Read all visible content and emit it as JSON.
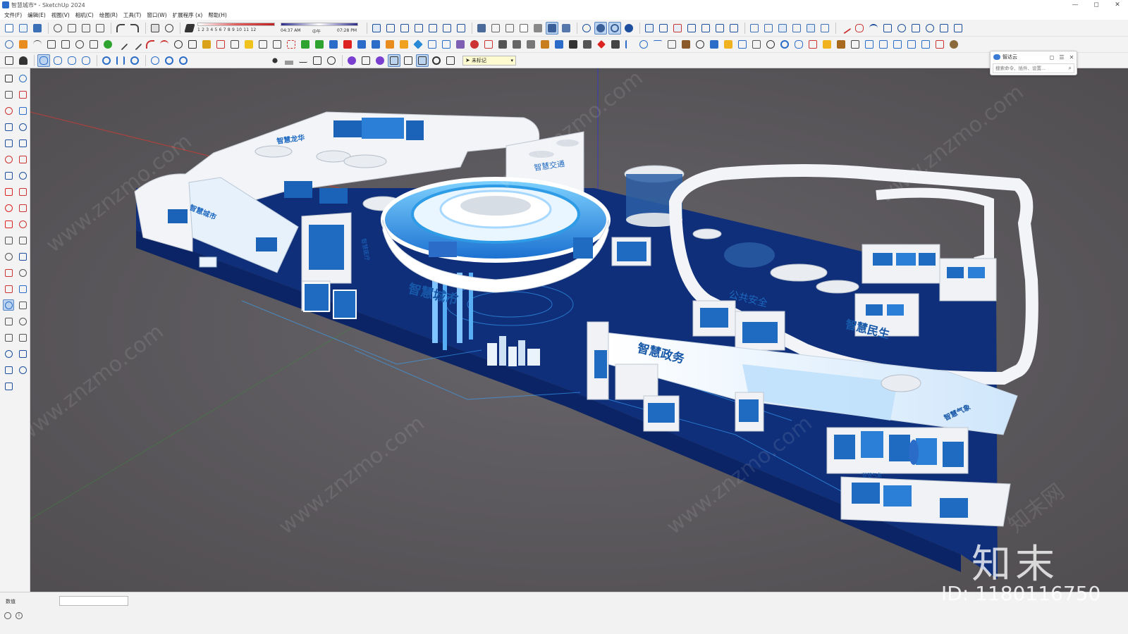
{
  "window": {
    "title": "智慧城市* - SketchUp 2024",
    "controls": [
      "—",
      "◻",
      "✕"
    ]
  },
  "menubar": {
    "items": [
      "文件(F)",
      "编辑(E)",
      "视图(V)",
      "相机(C)",
      "绘图(R)",
      "工具(T)",
      "窗口(W)",
      "扩展程序 (x)",
      "帮助(H)"
    ]
  },
  "shadow": {
    "months": "1  2  3  4  5  6  7  8  9  10  11  12",
    "sunrise": "04:37 AM",
    "noon": "中午",
    "sunset": "07:28 PM"
  },
  "tag_select": {
    "value": "未标记"
  },
  "search_panel": {
    "title": "智达云",
    "placeholder": "搜索命令、插件、设置..."
  },
  "statusbar": {
    "measure_label": "数值",
    "measure_value": ""
  },
  "scene_labels": {
    "smart_city": "智慧城市",
    "smart_longhua": "智慧龙华",
    "smart_traffic": "智慧交通",
    "smart_gov": "智慧政务",
    "smart_livelihood": "智慧民生",
    "public_safety": "公共安全",
    "smart_weather": "智慧气象",
    "smart_health": "智慧医疗"
  },
  "watermark": {
    "brand": "知末",
    "id": "ID: 1180116750",
    "site": "www.znzmo.com",
    "site_cn": "知末网"
  },
  "colors": {
    "viewport_bg": "#5e5b5c",
    "floor_blue": "#0f2f7a",
    "accent_blue": "#2e9be6",
    "white": "#f4f6fa",
    "toolbar_bg": "#f3f3f3"
  }
}
